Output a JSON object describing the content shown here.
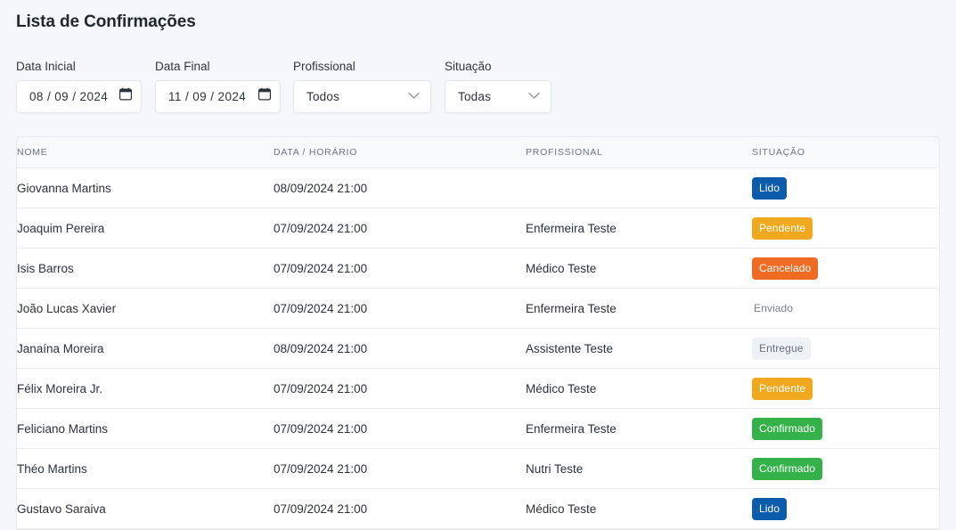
{
  "page": {
    "title": "Lista de Confirmações",
    "background_color": "#f5f7fa"
  },
  "filters": {
    "data_inicial": {
      "label": "Data Inicial",
      "value": "08 / 09 / 2024",
      "icon": "calendar-icon"
    },
    "data_final": {
      "label": "Data Final",
      "value": "11 / 09 / 2024",
      "icon": "calendar-icon"
    },
    "profissional": {
      "label": "Profissional",
      "value": "Todos",
      "icon": "chevron-down-icon"
    },
    "situacao": {
      "label": "Situação",
      "value": "Todas",
      "icon": "chevron-down-icon"
    }
  },
  "table": {
    "columns": [
      "NOME",
      "DATA / HORÁRIO",
      "PROFISSIONAL",
      "SITUAÇÃO"
    ],
    "rows": [
      {
        "nome": "Giovanna Martins",
        "data_horario": "08/09/2024 21:00",
        "profissional": "",
        "situacao": "Lido",
        "situacao_key": "lido"
      },
      {
        "nome": "Joaquim Pereira",
        "data_horario": "07/09/2024 21:00",
        "profissional": "Enfermeira Teste",
        "situacao": "Pendente",
        "situacao_key": "pendente"
      },
      {
        "nome": "Isis Barros",
        "data_horario": "07/09/2024 21:00",
        "profissional": "Médico Teste",
        "situacao": "Cancelado",
        "situacao_key": "cancelado"
      },
      {
        "nome": "João Lucas Xavier",
        "data_horario": "07/09/2024 21:00",
        "profissional": "Enfermeira Teste",
        "situacao": "Enviado",
        "situacao_key": "enviado"
      },
      {
        "nome": "Janaína Moreira",
        "data_horario": "08/09/2024 21:00",
        "profissional": "Assistente Teste",
        "situacao": "Entregue",
        "situacao_key": "entregue"
      },
      {
        "nome": "Félix Moreira Jr.",
        "data_horario": "07/09/2024 21:00",
        "profissional": "Médico Teste",
        "situacao": "Pendente",
        "situacao_key": "pendente"
      },
      {
        "nome": "Feliciano Martins",
        "data_horario": "07/09/2024 21:00",
        "profissional": "Enfermeira Teste",
        "situacao": "Confirmado",
        "situacao_key": "confirmado"
      },
      {
        "nome": "Théo Martins",
        "data_horario": "07/09/2024 21:00",
        "profissional": "Nutri Teste",
        "situacao": "Confirmado",
        "situacao_key": "confirmado"
      },
      {
        "nome": "Gustavo Saraiva",
        "data_horario": "07/09/2024 21:00",
        "profissional": "Médico Teste",
        "situacao": "Lido",
        "situacao_key": "lido"
      }
    ]
  },
  "status_colors": {
    "lido": "#0d5bab",
    "pendente": "#f0a91e",
    "cancelado": "#ef6a22",
    "confirmado": "#35b14a",
    "entregue": "#eef1f6",
    "enviado": "#78808c"
  }
}
